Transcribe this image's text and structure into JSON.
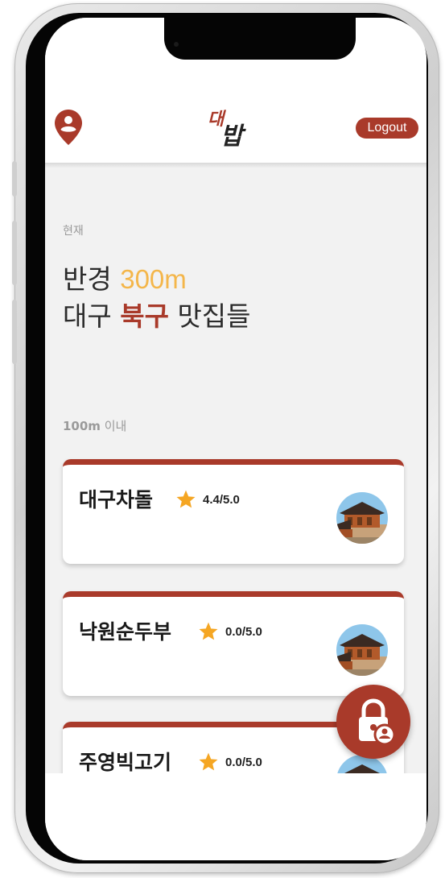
{
  "header": {
    "logo_top": "대",
    "logo_bottom": "밥",
    "logout_label": "Logout"
  },
  "main": {
    "current_label": "현재",
    "headline_prefix": "반경 ",
    "radius": "300m",
    "city": "대구 ",
    "district": "북구",
    "headline_suffix": " 맛집들",
    "section_label_distance": "100m",
    "section_label_suffix": " 이내"
  },
  "restaurants": [
    {
      "name": "대구차돌",
      "rating": "4.4/5.0"
    },
    {
      "name": "낙원순두부",
      "rating": "0.0/5.0"
    },
    {
      "name": "주영빅고기",
      "rating": "0.0/5.0"
    }
  ],
  "icons": {
    "location": "location-person-icon",
    "star": "star-icon",
    "fab": "lock-user-icon"
  },
  "colors": {
    "accent": "#a93a2a",
    "highlight": "#f4b64a",
    "star": "#f5a623"
  }
}
